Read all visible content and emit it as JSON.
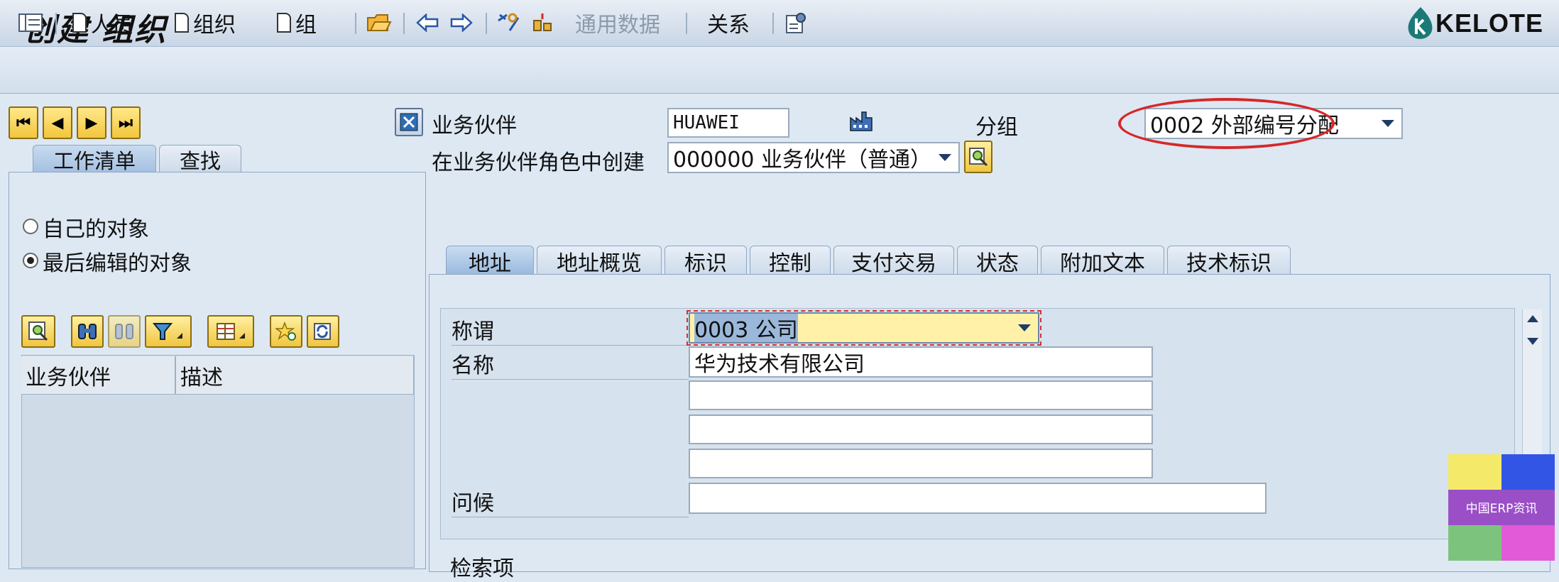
{
  "window": {
    "title": "创建 组织",
    "logo_text": "KELOTE"
  },
  "toolbar": {
    "person_label": "人员",
    "org_label": "组织",
    "group_label": "组",
    "general_data_label": "通用数据",
    "relations_label": "关系"
  },
  "header": {
    "bp_label": "业务伙伴",
    "bp_value": "HUAWEI",
    "grouping_label": "分组",
    "grouping_value": "0002 外部编号分配",
    "role_label": "在业务伙伴角色中创建",
    "role_value": "000000 业务伙伴（普通）"
  },
  "left": {
    "tabs": [
      "工作清单",
      "查找"
    ],
    "radio_own": "自己的对象",
    "radio_last": "最后编辑的对象",
    "columns": [
      "业务伙伴",
      "描述"
    ]
  },
  "tabs": [
    "地址",
    "地址概览",
    "标识",
    "控制",
    "支付交易",
    "状态",
    "附加文本",
    "技术标识"
  ],
  "address": {
    "title_label": "称谓",
    "title_value": "0003 公司",
    "name_label": "名称",
    "name_value": "华为技术有限公司",
    "name2": "",
    "name3": "",
    "name4": "",
    "greeting_label": "问候",
    "greeting_value": "",
    "search_terms_label": "检索项"
  },
  "watermark": {
    "text": "中国ERP资讯",
    "colors": [
      "#f5e96a",
      "#3355e6",
      "#9b4fc7",
      "#7cc47e",
      "#e35ad8"
    ]
  }
}
